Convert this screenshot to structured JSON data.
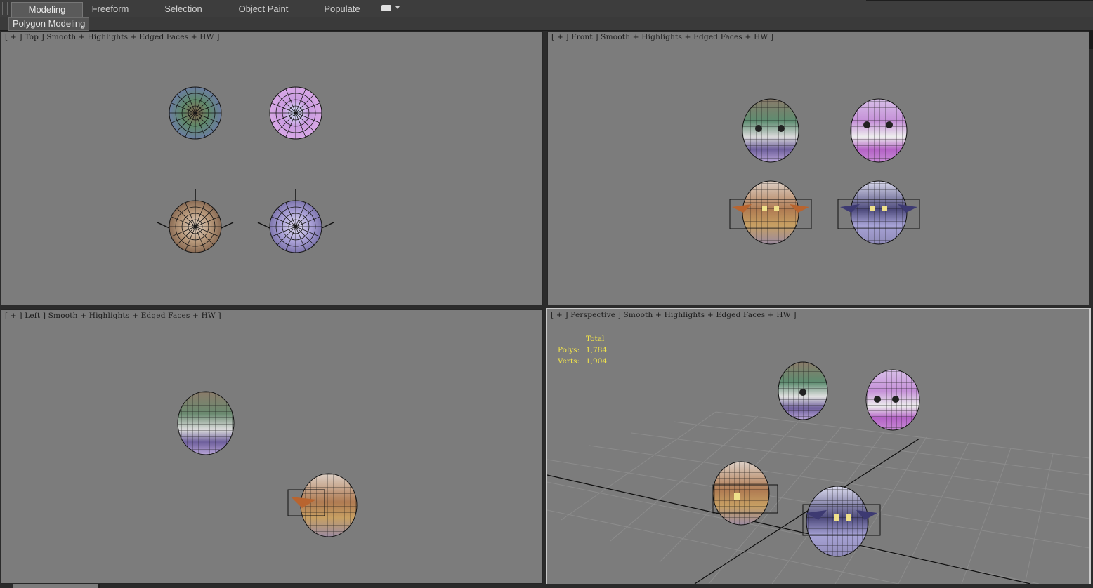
{
  "ribbon": {
    "tabs": [
      "Modeling",
      "Freeform",
      "Selection",
      "Object Paint",
      "Populate"
    ],
    "active_tab": "Modeling",
    "panel_label": "Polygon Modeling"
  },
  "viewports": {
    "top": {
      "label": "[ + ] Top ] Smooth + Highlights + Edged Faces + HW ]"
    },
    "front": {
      "label": "[ + ] Front ] Smooth + Highlights + Edged Faces + HW ]"
    },
    "left": {
      "label": "[ + ] Left ] Smooth + Highlights + Edged Faces + HW ]"
    },
    "perspective": {
      "label": "[ + ] Perspective ] Smooth + Highlights + Edged Faces + HW ]",
      "stats": {
        "total_label": "Total",
        "polys_label": "Polys:",
        "polys_value": "1,784",
        "verts_label": "Verts:",
        "verts_value": "1,904"
      }
    }
  },
  "colors": {
    "viewport_bg": "#7c7c7c",
    "ui_bg": "#3d3d3d",
    "stats_text": "#f1e34a",
    "wire": "#1a1a1a",
    "egg_green": "#6f8f73",
    "egg_pink": "#c79bd6",
    "egg_orange": "#c9a06b",
    "egg_purple": "#9b96c8"
  },
  "icons": [
    "viewport-dropdown-icon",
    "egg-mesh-icon"
  ]
}
